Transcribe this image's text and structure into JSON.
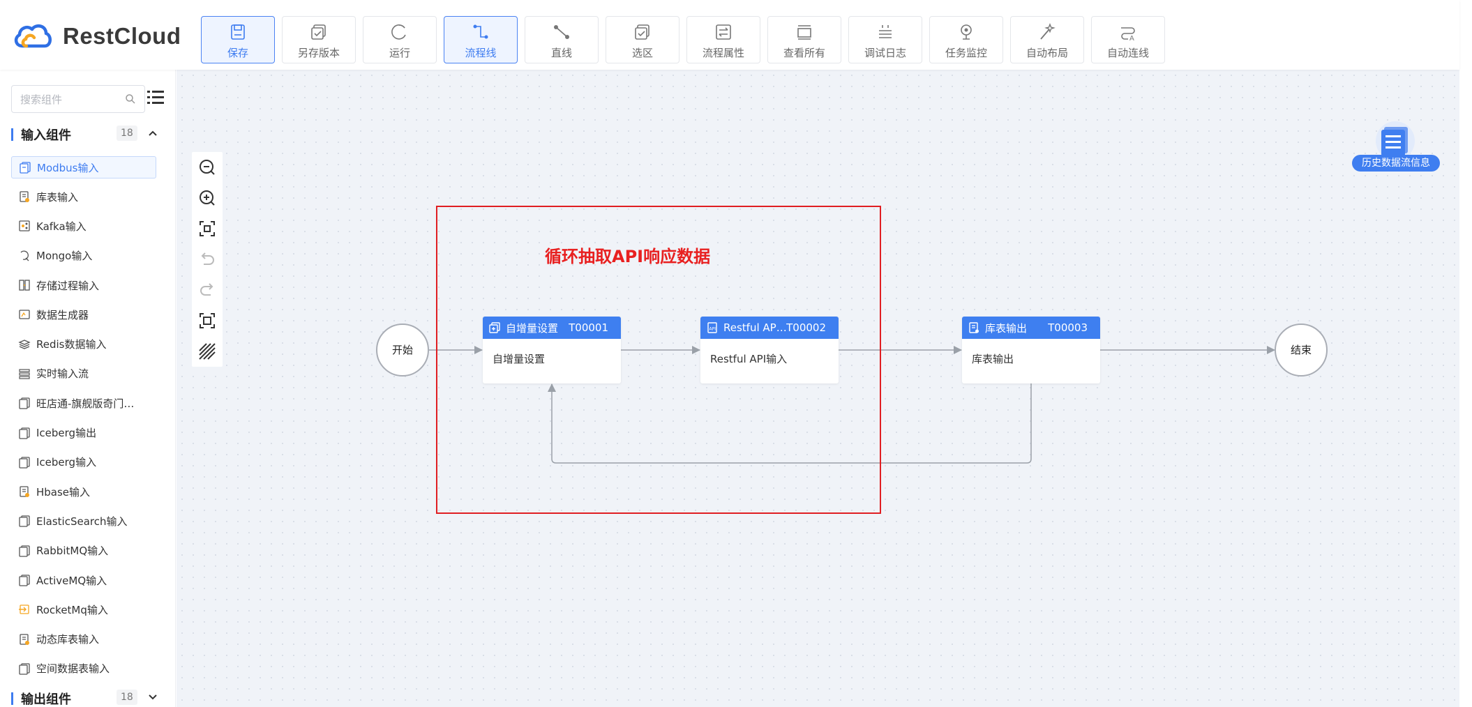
{
  "app": {
    "brand": "RestCloud"
  },
  "toolbar": [
    {
      "key": "save",
      "label": "保存",
      "icon": "save-icon",
      "active": true
    },
    {
      "key": "save-version",
      "label": "另存版本",
      "icon": "save-version-icon",
      "active": false
    },
    {
      "key": "run",
      "label": "运行",
      "icon": "run-icon",
      "active": false
    },
    {
      "key": "flowline",
      "label": "流程线",
      "icon": "flowline-icon",
      "active": true
    },
    {
      "key": "straight",
      "label": "直线",
      "icon": "straight-line-icon",
      "active": false
    },
    {
      "key": "select",
      "label": "选区",
      "icon": "selection-icon",
      "active": false
    },
    {
      "key": "props",
      "label": "流程属性",
      "icon": "process-properties-icon",
      "active": false
    },
    {
      "key": "view-all",
      "label": "查看所有",
      "icon": "view-all-icon",
      "active": false
    },
    {
      "key": "debug-log",
      "label": "调试日志",
      "icon": "debug-log-icon",
      "active": false
    },
    {
      "key": "monitor",
      "label": "任务监控",
      "icon": "task-monitor-icon",
      "active": false
    },
    {
      "key": "auto-layout",
      "label": "自动布局",
      "icon": "auto-layout-icon",
      "active": false
    },
    {
      "key": "auto-connect",
      "label": "自动连线",
      "icon": "auto-connect-icon",
      "active": false
    }
  ],
  "sidebar": {
    "search_placeholder": "搜索组件",
    "input_group": {
      "title": "输入组件",
      "count": "18"
    },
    "items": [
      {
        "label": "Modbus输入",
        "selected": true
      },
      {
        "label": "库表输入"
      },
      {
        "label": "Kafka输入"
      },
      {
        "label": "Mongo输入"
      },
      {
        "label": "存储过程输入"
      },
      {
        "label": "数据生成器"
      },
      {
        "label": "Redis数据输入"
      },
      {
        "label": "实时输入流"
      },
      {
        "label": "旺店通-旗舰版奇门…"
      },
      {
        "label": "Iceberg输出"
      },
      {
        "label": "Iceberg输入"
      },
      {
        "label": "Hbase输入"
      },
      {
        "label": "ElasticSearch输入"
      },
      {
        "label": "RabbitMQ输入"
      },
      {
        "label": "ActiveMQ输入"
      },
      {
        "label": "RocketMq输入"
      },
      {
        "label": "动态库表输入"
      },
      {
        "label": "空间数据表输入"
      }
    ],
    "output_group": {
      "title": "输出组件",
      "count": "18"
    }
  },
  "canvas": {
    "annotation": "循环抽取API响应数据",
    "start": "开始",
    "end": "结束",
    "nodes": [
      {
        "title": "自增量设置",
        "id": "T00001",
        "body": "自增量设置"
      },
      {
        "title": "Restful AP…",
        "id": "T00002",
        "body": "Restful API输入"
      },
      {
        "title": "库表输出",
        "id": "T00003",
        "body": "库表输出"
      }
    ],
    "history_label": "历史数据流信息"
  },
  "colors": {
    "accent": "#3e7ff0",
    "annotation": "#e01e22"
  }
}
